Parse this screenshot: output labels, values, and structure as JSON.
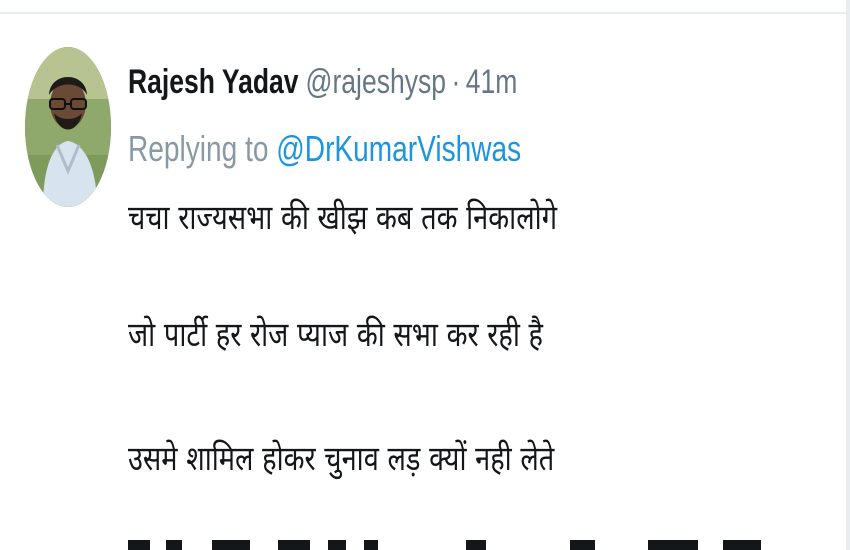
{
  "tweet": {
    "author": {
      "name": "Rajesh Yadav",
      "handle": "@rajeshysp",
      "separator": "·",
      "time": "41m"
    },
    "reply": {
      "prefix": "Replying to",
      "mention": "@DrKumarVishwas"
    },
    "lines": [
      "चचा राज्यसभा की खीझ कब तक निकालोगे",
      "जो पार्टी हर रोज प्याज की सभा कर रही है",
      "उसमे शामिल होकर चुनाव लड़ क्यों नही लेते"
    ]
  },
  "colors": {
    "name": "#14171a",
    "meta": "#657786",
    "reply": "#8899a6",
    "link": "#1b95e0",
    "divider": "#e6ecf0"
  }
}
